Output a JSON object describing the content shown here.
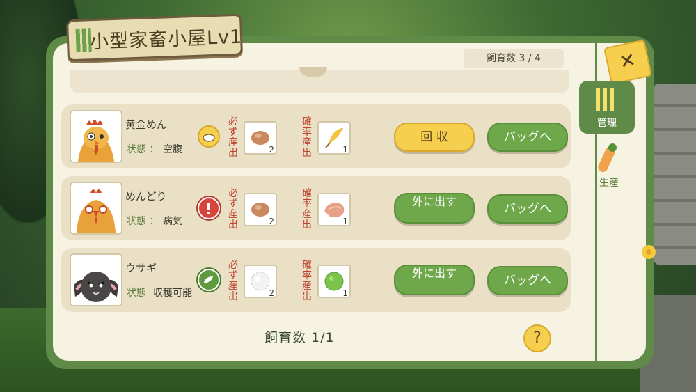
{
  "title": "小型家畜小屋Lv1",
  "capacity_top": "飼育数 3 / 4",
  "tabs": {
    "manage": "管理",
    "produce": "生産"
  },
  "status_label": "状態",
  "animals": [
    {
      "name": "黄金めん",
      "status_label": "状態 ：",
      "status": "空腹",
      "status_icon": "food-bowl-icon",
      "guaranteed_label": "必ず産出",
      "guaranteed_item": "egg-icon",
      "guaranteed_qty": "2",
      "chance_label": "確率産出",
      "chance_item": "feather-icon",
      "chance_qty": "1",
      "action": "回 収",
      "bag": "バッグへ"
    },
    {
      "name": "めんどり",
      "status_label": "状態 ：",
      "status": "病気",
      "status_icon": "warning-icon",
      "guaranteed_label": "必ず産出",
      "guaranteed_item": "egg-icon",
      "guaranteed_qty": "2",
      "chance_label": "確率産出",
      "chance_item": "chicken-meat-icon",
      "chance_qty": "1",
      "action": "外に出す",
      "bag": "バッグへ"
    },
    {
      "name": "ウサギ",
      "status_label": "状態",
      "status": "収穫可能",
      "status_icon": "harvest-ready-icon",
      "guaranteed_label": "必ず産出",
      "guaranteed_item": "wool-icon",
      "guaranteed_qty": "2",
      "chance_label": "確率産出",
      "chance_item": "green-ball-icon",
      "chance_qty": "1",
      "action": "外に出す",
      "bag": "バッグへ"
    }
  ],
  "capacity_bottom": "飼育数 1/1",
  "help": "?",
  "colors": {
    "panel_green": "#5f8a47",
    "button_green": "#6fa84a",
    "button_yellow": "#f7cf4e",
    "label_red": "#c0432f"
  }
}
